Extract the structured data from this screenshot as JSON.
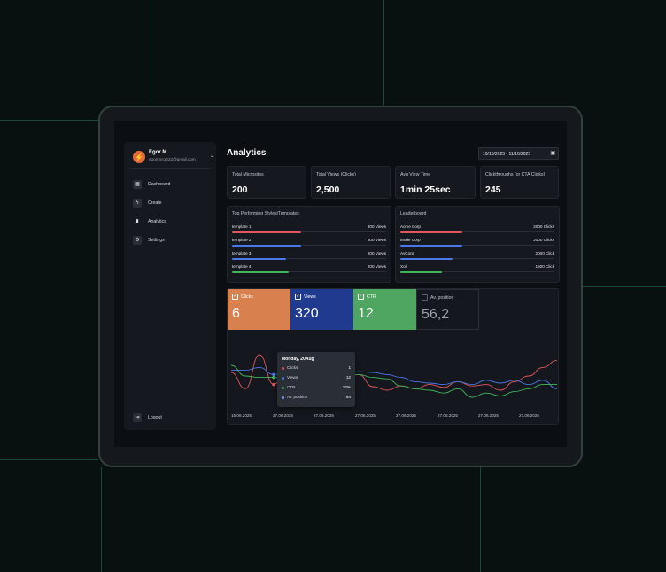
{
  "sidebar": {
    "user": {
      "name": "Egor M",
      "email": "egormm1222@gmail.com"
    },
    "items": [
      {
        "label": "Dashboard",
        "icon": "grid-icon"
      },
      {
        "label": "Create",
        "icon": "bolt-icon"
      },
      {
        "label": "Analytics",
        "icon": "bar-chart-icon"
      },
      {
        "label": "Settings",
        "icon": "gear-icon"
      }
    ],
    "logout": "Logout"
  },
  "header": {
    "title": "Analytics",
    "date_range": "10/10/2025 - 11/10/2025"
  },
  "stats": [
    {
      "label": "Total Microsites",
      "value": "200"
    },
    {
      "label": "Total Views (Clicks)",
      "value": "2,500"
    },
    {
      "label": "Avg View Time",
      "value": "1min 25sec"
    },
    {
      "label": "Clickthroughs (or CTA Clicks)",
      "value": "245"
    }
  ],
  "top_templates": {
    "title": "Top Performing Styles/Templates",
    "rows": [
      {
        "name": "template 1",
        "value": "300 Views",
        "progress": 0.45,
        "color": "#e0575e"
      },
      {
        "name": "template 2",
        "value": "300 Views",
        "progress": 0.45,
        "color": "#4a78e8"
      },
      {
        "name": "template 3",
        "value": "200 Views",
        "progress": 0.35,
        "color": "#4a78e8"
      },
      {
        "name": "template 4",
        "value": "200 Views",
        "progress": 0.37,
        "color": "#3fb65a"
      }
    ]
  },
  "leaderboard": {
    "title": "Leaderboard",
    "rows": [
      {
        "name": "Acme Corp",
        "value": "2000 Clicks",
        "progress": 0.4,
        "color": "#e0575e"
      },
      {
        "name": "Mode Corp",
        "value": "2000 Clicks",
        "progress": 0.4,
        "color": "#4a78e8"
      },
      {
        "name": "AyCorp",
        "value": "2000 Click",
        "progress": 0.34,
        "color": "#4a78e8"
      },
      {
        "name": "Xol",
        "value": "1500 Click",
        "progress": 0.27,
        "color": "#3fb65a"
      }
    ]
  },
  "metrics": [
    {
      "label": "Clicks",
      "value": "6",
      "checked": true,
      "color": "#d9804f"
    },
    {
      "label": "Views",
      "value": "320",
      "checked": true,
      "color": "#1f3a8f"
    },
    {
      "label": "CTR",
      "value": "12",
      "checked": true,
      "color": "#4ea660"
    },
    {
      "label": "Av. position",
      "value": "56,2",
      "checked": false,
      "color": "#14171d"
    }
  ],
  "chart_data": {
    "type": "line",
    "x": [
      "15.06.2025",
      "27.06.2025",
      "27.06.2025",
      "27.06.2025",
      "27.06.2025",
      "27.06.2025",
      "27.06.2025",
      "27.06.2025"
    ],
    "series": [
      {
        "name": "Clicks",
        "color": "#e0575e",
        "values": [
          0.55,
          0.78,
          0.3,
          0.72,
          0.45,
          0.78,
          0.38,
          0.72,
          0.6,
          0.58,
          0.75,
          0.8,
          0.74,
          0.78,
          0.72,
          0.76,
          0.68,
          0.74,
          0.72,
          0.8,
          0.68,
          0.6,
          0.48,
          0.38
        ]
      },
      {
        "name": "Views",
        "color": "#4a78e8",
        "values": [
          0.52,
          0.52,
          0.48,
          0.58,
          0.55,
          0.72,
          0.56,
          0.54,
          0.58,
          0.54,
          0.55,
          0.58,
          0.62,
          0.68,
          0.7,
          0.72,
          0.68,
          0.72,
          0.66,
          0.7,
          0.66,
          0.72,
          0.66,
          0.78
        ]
      },
      {
        "name": "CTR",
        "color": "#3fb65a",
        "values": [
          0.45,
          0.6,
          0.62,
          0.62,
          0.64,
          0.56,
          0.52,
          0.58,
          0.58,
          0.58,
          0.62,
          0.64,
          0.74,
          0.78,
          0.8,
          0.84,
          0.78,
          0.9,
          0.84,
          0.88,
          0.82,
          0.78,
          0.72,
          0.72
        ]
      }
    ],
    "tooltip": {
      "title": "Monday, 20Aug",
      "rows": [
        {
          "label": "Clicks",
          "value": "1",
          "color": "#e0575e"
        },
        {
          "label": "Views",
          "value": "12",
          "color": "#4a78e8"
        },
        {
          "label": "CTR",
          "value": "12%",
          "color": "#3fb65a"
        },
        {
          "label": "Av. position",
          "value": "64",
          "color": "#7da3e8"
        }
      ]
    }
  }
}
